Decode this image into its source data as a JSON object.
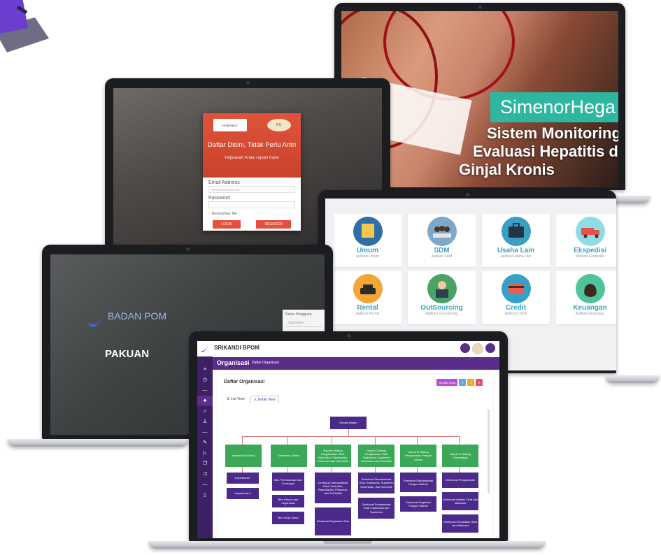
{
  "screens": {
    "simenor": {
      "title": "SimenorHega",
      "subtitle_lines": [
        "Sistem Monitoring dan",
        "Evaluasi Hepatitis dan",
        "Ginjal Kronis"
      ]
    },
    "login": {
      "heading": "Daftar Disini, Tidak Perlu Antri",
      "tagline": "Kepuasan Anda Tujuan Kami",
      "email_label": "Email Address",
      "email_placeholder": "member@gmail.com",
      "password_label": "Password",
      "remember_label": "Remember Me",
      "login_button": "LOGIN",
      "register_button": "REGISTER"
    },
    "pakuan": {
      "logo_text": "BADAN POM",
      "title": "PAKUAN",
      "login_label": "Nama Pengguna",
      "login_value": "superuser"
    },
    "apps": {
      "items": [
        {
          "name": "Umum",
          "sub": "Aplikasi Umum",
          "color": "#2f6fa8",
          "icon": "box-icon"
        },
        {
          "name": "SDM",
          "sub": "Aplikasi SDM",
          "color": "#7ea8c9",
          "icon": "people-icon"
        },
        {
          "name": "Usaha Lain",
          "sub": "Aplikasi Usaha Lain",
          "color": "#3aa0c2",
          "icon": "briefcase-icon"
        },
        {
          "name": "Ekspedisi",
          "sub": "Aplikasi Ekspedisi",
          "color": "#8fdbe6",
          "icon": "truck-icon"
        },
        {
          "name": "Rental",
          "sub": "Aplikasi Rental",
          "color": "#f3a636",
          "icon": "car-icon"
        },
        {
          "name": "OutSourcing",
          "sub": "Aplikasi Outsourcing",
          "color": "#4aa364",
          "icon": "worker-icon"
        },
        {
          "name": "Credit",
          "sub": "Aplikasi Credit",
          "color": "#35a1c9",
          "icon": "card-icon"
        },
        {
          "name": "Keuangan",
          "sub": "Aplikasi Keuangan",
          "color": "#4fc39a",
          "icon": "money-bag-icon"
        }
      ]
    },
    "srikandi": {
      "brand": "SRIKANDI BPOM",
      "section_title": "Organisasi",
      "breadcrumb": "Daftar Organisasi",
      "card_title": "Daftar Organisasi",
      "add_button": "Tambah Data",
      "tab_list": "List View",
      "tab_detail": "Detail View",
      "org": {
        "root": "Kepala Badan",
        "level1": [
          "Inspektorat Utama",
          "Sekretaris Utama",
          "Deputi I Bidang Pengawasan Obat, Narkotika, Psikotropika, Prekursor dan Zat Adiktif",
          "Deputi II Bidang Pengawasan Obat Tradisional, Suplemen Kesehatan dan Kosmetik",
          "Deputi III Bidang Pengawasan Pangan Olahan",
          "Deputi IV Bidang Penindakan"
        ],
        "level2": [
          [
            "Inspektorat I",
            "Inspektorat II"
          ],
          [
            "Biro Perencanaan dan Keuangan",
            "Biro Hukum dan Organisasi",
            "Biro Kerja Sama"
          ],
          [
            "Direktorat Standardisasi Obat, Narkotika, Psikotropika, Prekursor, dan Zat Adiktif",
            "Direktorat Registrasi Obat"
          ],
          [
            "Direktorat Standardisasi Obat Tradisional, Suplemen Kesehatan, dan Kosmetik",
            "Direktorat Pengawasan Obat Tradisional dan Suplemen"
          ],
          [
            "Direktorat Standardisasi Pangan Olahan",
            "Direktorat Registrasi Pangan Olahan"
          ],
          [
            "Direktorat Pengamanan",
            "Direktorat Intelijen Obat dan Makanan",
            "Direktorat Penyidikan Obat dan Makanan"
          ]
        ]
      }
    }
  }
}
